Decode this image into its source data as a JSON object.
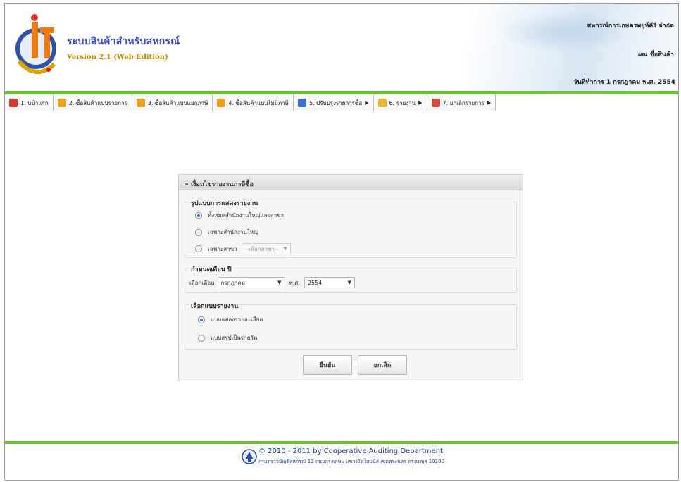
{
  "header": {
    "title": "ระบบสินค้าสำหรับสหกรณ์",
    "version": "Version 2.1 (Web Edition)",
    "cooperative_name": "สหกรณ์การเกษตรพยุห์คีรี จำกัด",
    "user_label": "ผณ ชื่อสินค้า",
    "work_date": "วันที่ทำการ 1 กรกฎาคม พ.ศ. 2554"
  },
  "menu": [
    {
      "label": "1. หน้าแรก",
      "icon": "home-icon",
      "has_arrow": false
    },
    {
      "label": "2. ซื้อสินค้าแบบรายการ",
      "icon": "cart-icon",
      "has_arrow": false
    },
    {
      "label": "3. ซื้อสินค้าแบบแยกภาษี",
      "icon": "cart-icon",
      "has_arrow": false
    },
    {
      "label": "4. ซื้อสินค้าแบบไม่มีภาษี",
      "icon": "cart-icon",
      "has_arrow": false
    },
    {
      "label": "5. ปรับปรุงรายการซื้อ",
      "icon": "save-icon",
      "has_arrow": true
    },
    {
      "label": "6. รายงาน",
      "icon": "report-icon",
      "has_arrow": true
    },
    {
      "label": "7. ยกเลิกรายการ",
      "icon": "cancel-doc-icon",
      "has_arrow": true
    }
  ],
  "panel": {
    "title": "» เงื่อนไขรายงานภาษีซื้อ",
    "display_section": {
      "legend": "รูปแบบการแสดงรายงาน",
      "options": [
        {
          "label": "ทั้งหมดสำนักงานใหญ่และสาขา",
          "checked": true
        },
        {
          "label": "เฉพาะสำนักงานใหญ่",
          "checked": false
        },
        {
          "label": "เฉพาะสาขา",
          "checked": false
        }
      ],
      "branch_select": "--เลือกสาขา--"
    },
    "period_section": {
      "legend": "กำหนดเดือน ปี",
      "month_label": "เลือกเดือน",
      "month_value": "กรกฎาคม",
      "year_label": "พ.ศ.",
      "year_value": "2554"
    },
    "report_section": {
      "legend": "เลือกแบบรายงาน",
      "options": [
        {
          "label": "แบบแสดงรายละเอียด",
          "checked": true
        },
        {
          "label": "แบบสรุปเป็นรายวัน",
          "checked": false
        }
      ]
    },
    "confirm_label": "ยืนยัน",
    "cancel_label": "ยกเลิก"
  },
  "footer": {
    "copyright": "© 2010 - 2011  by Cooperative Auditing Department",
    "address": "กรมตรวจบัญชีสหกรณ์ 12 ถนนกรุงเกษม แขวงวัดโสมนัส เขตพระนคร กรุงเทพฯ 10200"
  },
  "colors": {
    "accent_green": "#6fbf3a",
    "brand_blue": "#3a49c9",
    "brand_gold": "#c48a00",
    "footer_text": "#1e3c9a"
  }
}
